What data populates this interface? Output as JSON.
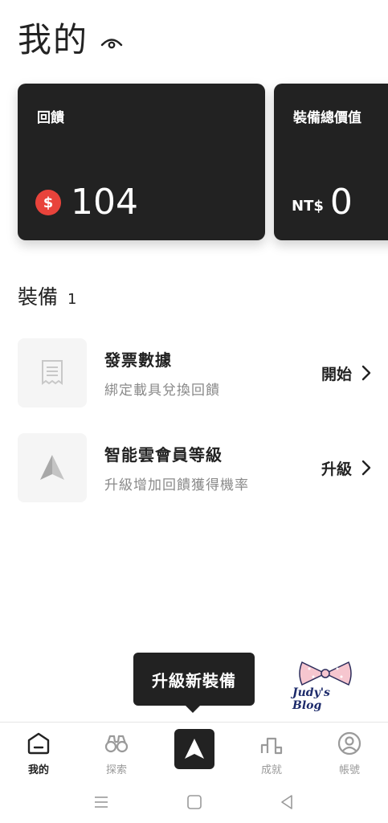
{
  "header": {
    "title": "我的",
    "visibility_icon": "eye-icon"
  },
  "cards": {
    "feedback": {
      "title": "回饋",
      "currency_symbol": "$",
      "amount": "104"
    },
    "equipment_value": {
      "title": "裝備總價值",
      "prefix": "NT$",
      "amount": "0"
    }
  },
  "equipment": {
    "title": "裝備",
    "count": "1",
    "items": [
      {
        "name": "發票數據",
        "desc": "綁定載具兌換回饋",
        "action": "開始",
        "icon": "receipt-icon"
      },
      {
        "name": "智能雲會員等級",
        "desc": "升級增加回饋獲得機率",
        "action": "升級",
        "icon": "arrow-logo-icon"
      }
    ]
  },
  "tooltip": {
    "text": "升級新裝備"
  },
  "watermark": {
    "text": "Judy's Blog"
  },
  "nav": {
    "items": [
      {
        "label": "我的",
        "icon": "home-icon",
        "active": true
      },
      {
        "label": "探索",
        "icon": "binoculars-icon"
      },
      {
        "label": "",
        "icon": "arrow-logo-icon"
      },
      {
        "label": "成就",
        "icon": "podium-icon"
      },
      {
        "label": "帳號",
        "icon": "account-icon"
      }
    ]
  },
  "system_bar": {
    "icons": [
      "menu-icon",
      "home-square-icon",
      "back-icon"
    ]
  },
  "colors": {
    "card_bg": "#222222",
    "coin": "#e8433b",
    "muted_text": "#8a8a8a"
  }
}
